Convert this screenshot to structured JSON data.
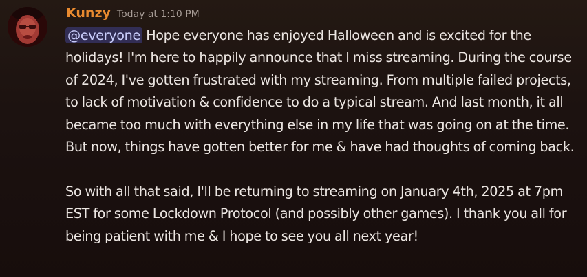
{
  "author": {
    "username": "Kunzy",
    "timestamp": "Today at 1:10 PM",
    "avatar_icon": "avatar-image",
    "username_color": "#e98a2f"
  },
  "message": {
    "mention": "@everyone",
    "paragraph1_text": " Hope everyone has enjoyed Halloween and is excited for the holidays! I'm here to happily announce that I miss streaming. During the course of 2024, I've gotten frustrated with my streaming. From multiple failed projects, to lack of motivation & confidence to do a typical stream. And last month, it all became too much with everything else in my life that was going on at the time. But now, things have gotten better for me & have had thoughts of coming back.",
    "paragraph2_text": "So with all that said, I'll be returning to streaming on January 4th, 2025 at 7pm EST for some Lockdown Protocol (and possibly other games). I thank you all for being patient with me & I hope to see you all next year!"
  },
  "colors": {
    "background": "#1c1210",
    "text": "#ece6e2",
    "mention_bg": "rgba(88,101,242,0.30)",
    "mention_text": "#c9cdfb",
    "timestamp": "#a79c96"
  }
}
